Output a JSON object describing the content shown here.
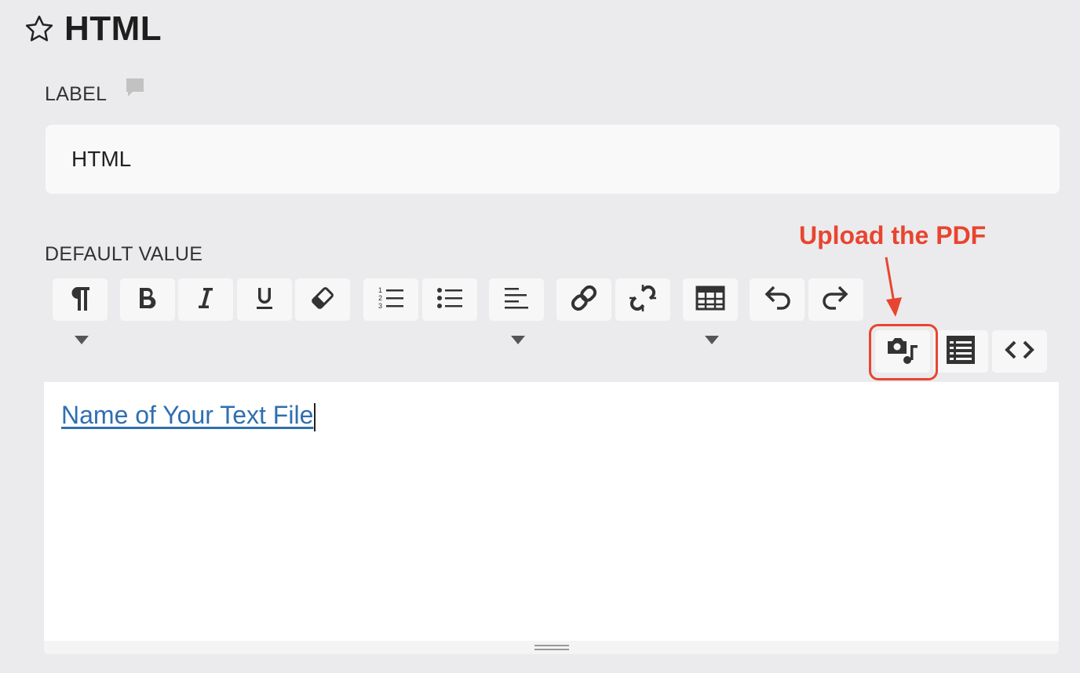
{
  "header": {
    "title": "HTML",
    "star_icon": "star-outline-icon"
  },
  "label_field": {
    "label": "LABEL",
    "value": "HTML",
    "comment_icon": "comment-icon"
  },
  "default_value": {
    "label": "DEFAULT VALUE"
  },
  "toolbar": {
    "buttons": [
      {
        "name": "paragraph-format-button",
        "icon": "pilcrow-icon",
        "dropdown": true
      },
      {
        "name": "bold-button",
        "icon": "bold-icon"
      },
      {
        "name": "italic-button",
        "icon": "italic-icon"
      },
      {
        "name": "underline-button",
        "icon": "underline-icon"
      },
      {
        "name": "clear-formatting-button",
        "icon": "eraser-icon"
      },
      {
        "name": "ordered-list-button",
        "icon": "ordered-list-icon"
      },
      {
        "name": "unordered-list-button",
        "icon": "unordered-list-icon"
      },
      {
        "name": "align-button",
        "icon": "align-left-icon",
        "dropdown": true
      },
      {
        "name": "insert-link-button",
        "icon": "link-icon"
      },
      {
        "name": "unlink-button",
        "icon": "unlink-icon"
      },
      {
        "name": "table-button",
        "icon": "table-icon",
        "dropdown": true
      },
      {
        "name": "undo-button",
        "icon": "undo-icon"
      },
      {
        "name": "redo-button",
        "icon": "redo-icon"
      },
      {
        "name": "media-button",
        "icon": "media-icon"
      },
      {
        "name": "template-button",
        "icon": "list-icon"
      },
      {
        "name": "source-code-button",
        "icon": "code-icon"
      }
    ]
  },
  "annotation": {
    "text": "Upload the PDF",
    "color": "#e84530"
  },
  "editor": {
    "content": "Name of Your Text File",
    "link_color": "#2f6fb0"
  }
}
